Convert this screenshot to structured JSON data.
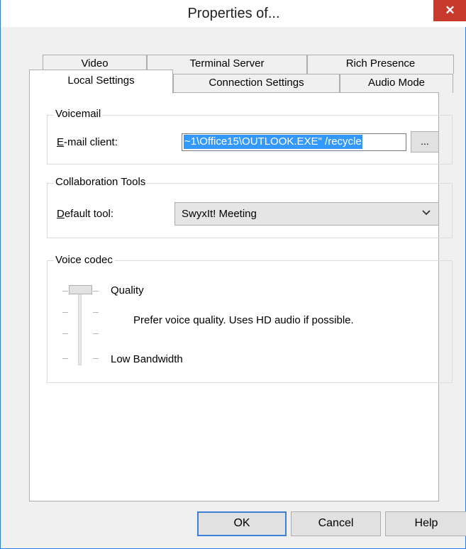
{
  "window": {
    "title": "Properties of...",
    "close_glyph": "✕"
  },
  "tabs": {
    "back_row": [
      "Video",
      "Terminal Server",
      "Rich Presence"
    ],
    "front_row": [
      "Local Settings",
      "Connection Settings",
      "Audio Mode"
    ],
    "active": "Local Settings"
  },
  "voicemail": {
    "group_label": "Voicemail",
    "email_label_accel": "E",
    "email_label_rest": "-mail client:",
    "email_value": "~1\\Office15\\OUTLOOK.EXE\" /recycle",
    "browse_label": "..."
  },
  "collab": {
    "group_label": "Collaboration Tools",
    "tool_label_accel": "D",
    "tool_label_rest": "efault tool:",
    "tool_value": "SwyxIt! Meeting",
    "dropdown_icon": "chevron-down-icon"
  },
  "codec": {
    "group_label": "Voice codec",
    "top_label": "Quality",
    "bottom_label": "Low Bandwidth",
    "description": "Prefer voice quality. Uses HD audio if possible.",
    "slider_level": 1.0
  },
  "buttons": {
    "ok": "OK",
    "cancel": "Cancel",
    "help": "Help"
  }
}
